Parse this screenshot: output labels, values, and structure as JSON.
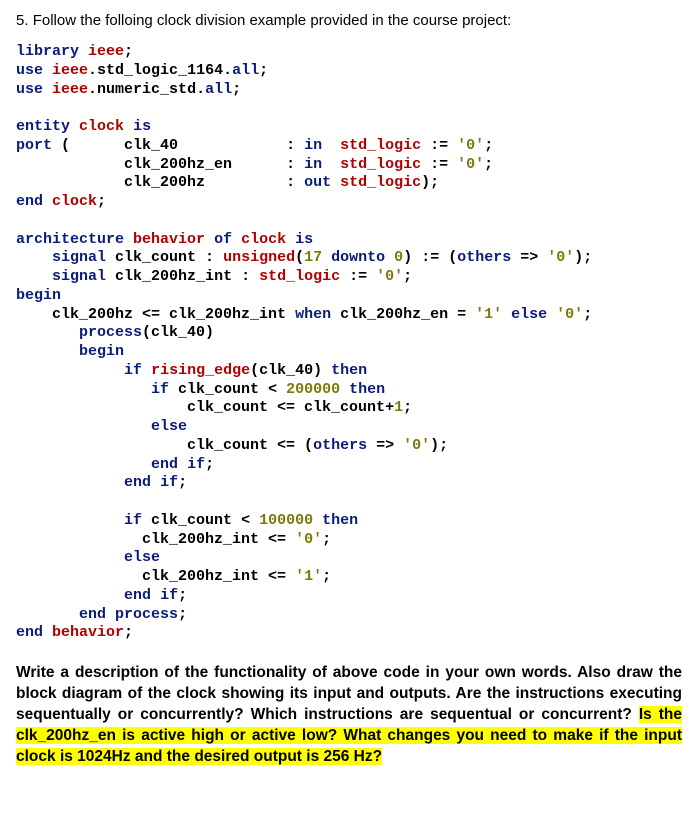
{
  "question_number": "5.",
  "question_prompt": "Follow the folloing clock division example provided in the course project:",
  "code": {
    "l1a": "library",
    "l1b": "ieee",
    "l1c": ";",
    "l2a": "use",
    "l2b": "ieee",
    "l2c": ".std_logic_1164.",
    "l2d": "all",
    "l2e": ";",
    "l3a": "use",
    "l3b": "ieee",
    "l3c": ".numeric_std.",
    "l3d": "all",
    "l3e": ";",
    "l5a": "entity",
    "l5b": "clock",
    "l5c": "is",
    "l6a": "port",
    "l6b": " (",
    "l6c": "clk_40",
    "l6d": ": ",
    "l6e": "in",
    "l6f": "std_logic",
    "l6g": " := ",
    "l6h": "'0'",
    "l6i": ";",
    "l7a": "clk_200hz_en",
    "l7b": ": ",
    "l7c": "in",
    "l7d": "std_logic",
    "l7e": " := ",
    "l7f": "'0'",
    "l7g": ";",
    "l8a": "clk_200hz",
    "l8b": ": ",
    "l8c": "out",
    "l8d": "std_logic",
    "l8e": ");",
    "l9a": "end",
    "l9b": "clock",
    "l9c": ";",
    "l11a": "architecture",
    "l11b": "behavior",
    "l11c": "of",
    "l11d": "clock",
    "l11e": "is",
    "l12a": "signal",
    "l12b": "clk_count : ",
    "l12c": "unsigned",
    "l12d": "(",
    "l12e": "17",
    "l12f": "downto",
    "l12g": "0",
    "l12h": ") := (",
    "l12i": "others",
    "l12j": " => ",
    "l12k": "'0'",
    "l12l": ");",
    "l13a": "signal",
    "l13b": "clk_200hz_int : ",
    "l13c": "std_logic",
    "l13d": " := ",
    "l13e": "'0'",
    "l13f": ";",
    "l14a": "begin",
    "l15a": "clk_200hz <= clk_200hz_int ",
    "l15b": "when",
    "l15c": " clk_200hz_en = ",
    "l15d": "'1'",
    "l15e": "else",
    "l15f": "'0'",
    "l15g": ";",
    "l16a": "process",
    "l16b": "(clk_40)",
    "l17a": "begin",
    "l18a": "if",
    "l18b": "rising_edge",
    "l18c": "(clk_40) ",
    "l18d": "then",
    "l19a": "if",
    "l19b": " clk_count < ",
    "l19c": "200000",
    "l19d": "then",
    "l20a": "clk_count <= clk_count+",
    "l20b": "1",
    "l20c": ";",
    "l21a": "else",
    "l22a": "clk_count <= (",
    "l22b": "others",
    "l22c": " => ",
    "l22d": "'0'",
    "l22e": ");",
    "l23a": "end",
    "l23b": "if",
    "l23c": ";",
    "l24a": "end",
    "l24b": "if",
    "l24c": ";",
    "l26a": "if",
    "l26b": " clk_count < ",
    "l26c": "100000",
    "l26d": "then",
    "l27a": "clk_200hz_int <= ",
    "l27b": "'0'",
    "l27c": ";",
    "l28a": "else",
    "l29a": "clk_200hz_int <= ",
    "l29b": "'1'",
    "l29c": ";",
    "l30a": "end",
    "l30b": "if",
    "l30c": ";",
    "l31a": "end",
    "l31b": "process",
    "l31c": ";",
    "l32a": "end",
    "l32b": "behavior",
    "l32c": ";"
  },
  "instr": {
    "p1": "Write a description of the functionality of above code in your own words. Also draw the block diagram of the clock showing its input and outputs. Are the instructions executing sequentually or concurrently? Which instructions are sequentual or concurrent? ",
    "h1": "Is the clk_200hz_en is active high or active low? What changes you need to make if the input clock is 1024Hz and the desired output is 256 Hz?"
  }
}
